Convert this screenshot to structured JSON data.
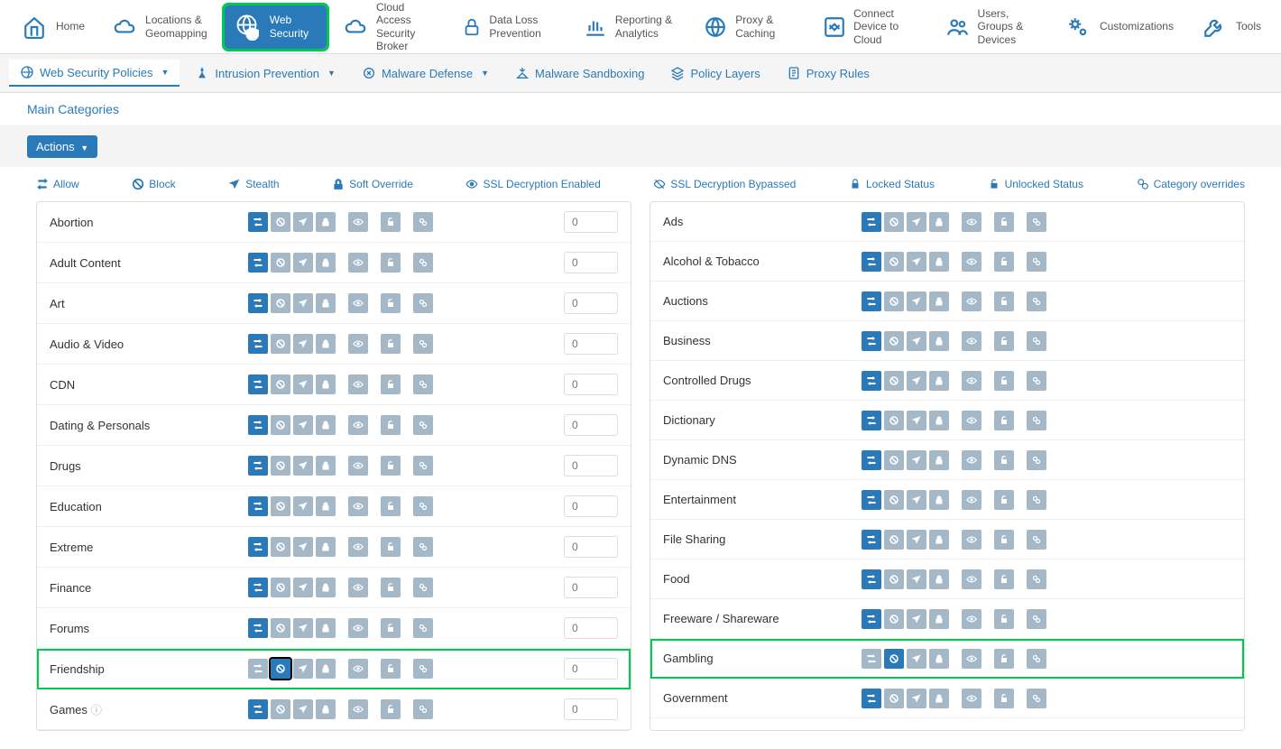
{
  "topNav": [
    {
      "label": "Home",
      "icon": "home"
    },
    {
      "label": "Locations & Geomapping",
      "icon": "cloud"
    },
    {
      "label": "Web Security",
      "icon": "globe-shield",
      "active": true
    },
    {
      "label": "Cloud Access Security Broker",
      "icon": "casb"
    },
    {
      "label": "Data Loss Prevention",
      "icon": "lock"
    },
    {
      "label": "Reporting & Analytics",
      "icon": "chart"
    },
    {
      "label": "Proxy & Caching",
      "icon": "proxy"
    },
    {
      "label": "Connect Device to Cloud",
      "icon": "connect"
    },
    {
      "label": "Users, Groups & Devices",
      "icon": "users"
    },
    {
      "label": "Customizations",
      "icon": "gears"
    },
    {
      "label": "Tools",
      "icon": "wrench"
    }
  ],
  "subNav": [
    {
      "label": "Web Security Policies",
      "icon": "globe",
      "dropdown": true,
      "active": true
    },
    {
      "label": "Intrusion Prevention",
      "icon": "intrusion",
      "dropdown": true
    },
    {
      "label": "Malware Defense",
      "icon": "malware",
      "dropdown": true
    },
    {
      "label": "Malware Sandboxing",
      "icon": "sandbox"
    },
    {
      "label": "Policy Layers",
      "icon": "layers"
    },
    {
      "label": "Proxy Rules",
      "icon": "rules"
    }
  ],
  "pageTitle": "Main Categories",
  "actionsLabel": "Actions",
  "legend": [
    {
      "label": "Allow",
      "icon": "allow"
    },
    {
      "label": "Block",
      "icon": "block"
    },
    {
      "label": "Stealth",
      "icon": "stealth"
    },
    {
      "label": "Soft Override",
      "icon": "soft"
    },
    {
      "label": "SSL Decryption Enabled",
      "icon": "ssl-on"
    },
    {
      "label": "SSL Decryption Bypassed",
      "icon": "ssl-off"
    },
    {
      "label": "Locked Status",
      "icon": "locked"
    },
    {
      "label": "Unlocked Status",
      "icon": "unlocked"
    },
    {
      "label": "Category overrides",
      "icon": "override"
    }
  ],
  "countPlaceholder": "0",
  "categoriesLeft": [
    {
      "label": "Abortion",
      "active": "allow"
    },
    {
      "label": "Adult Content",
      "active": "allow"
    },
    {
      "label": "Art",
      "active": "allow"
    },
    {
      "label": "Audio & Video",
      "active": "allow"
    },
    {
      "label": "CDN",
      "active": "allow"
    },
    {
      "label": "Dating & Personals",
      "active": "allow"
    },
    {
      "label": "Drugs",
      "active": "allow"
    },
    {
      "label": "Education",
      "active": "allow"
    },
    {
      "label": "Extreme",
      "active": "allow"
    },
    {
      "label": "Finance",
      "active": "allow"
    },
    {
      "label": "Forums",
      "active": "allow"
    },
    {
      "label": "Friendship",
      "active": "block",
      "highlighted": true,
      "selected": true
    },
    {
      "label": "Games",
      "active": "allow",
      "info": true
    }
  ],
  "categoriesRight": [
    {
      "label": "Ads",
      "active": "allow"
    },
    {
      "label": "Alcohol & Tobacco",
      "active": "allow"
    },
    {
      "label": "Auctions",
      "active": "allow"
    },
    {
      "label": "Business",
      "active": "allow"
    },
    {
      "label": "Controlled Drugs",
      "active": "allow"
    },
    {
      "label": "Dictionary",
      "active": "allow"
    },
    {
      "label": "Dynamic DNS",
      "active": "allow"
    },
    {
      "label": "Entertainment",
      "active": "allow"
    },
    {
      "label": "File Sharing",
      "active": "allow"
    },
    {
      "label": "Food",
      "active": "allow"
    },
    {
      "label": "Freeware / Shareware",
      "active": "allow"
    },
    {
      "label": "Gambling",
      "active": "block",
      "highlighted": true
    },
    {
      "label": "Government",
      "active": "allow"
    }
  ]
}
